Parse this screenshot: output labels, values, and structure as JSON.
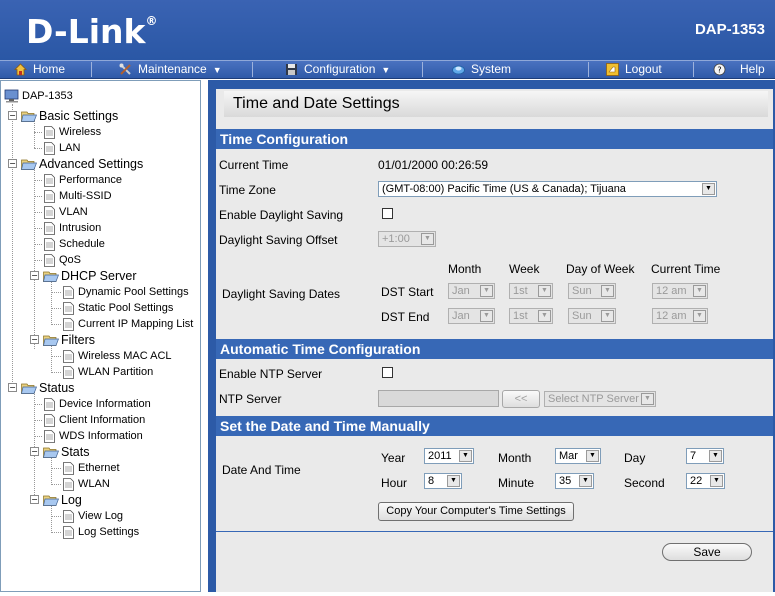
{
  "header": {
    "logo_text": "D-Link",
    "logo_mark": "®",
    "model": "DAP-1353"
  },
  "menu": {
    "home": "Home",
    "maintenance": "Maintenance",
    "configuration": "Configuration",
    "system": "System",
    "logout": "Logout",
    "help": "Help",
    "dropdown_glyph": "▼"
  },
  "tree": {
    "root": "DAP-1353",
    "basic": "Basic Settings",
    "wireless": "Wireless",
    "lan": "LAN",
    "advanced": "Advanced Settings",
    "performance": "Performance",
    "multi_ssid": "Multi-SSID",
    "vlan": "VLAN",
    "intrusion": "Intrusion",
    "schedule": "Schedule",
    "qos": "QoS",
    "dhcp": "DHCP Server",
    "dynamic_pool": "Dynamic Pool Settings",
    "static_pool": "Static Pool Settings",
    "ip_mapping": "Current IP Mapping List",
    "filters": "Filters",
    "mac_acl": "Wireless MAC ACL",
    "wlan_partition": "WLAN Partition",
    "status": "Status",
    "device_info": "Device Information",
    "client_info": "Client Information",
    "wds_info": "WDS Information",
    "stats": "Stats",
    "ethernet": "Ethernet",
    "wlan": "WLAN",
    "log": "Log",
    "view_log": "View Log",
    "log_settings": "Log Settings",
    "minus": "−"
  },
  "page": {
    "title": "Time and Date Settings"
  },
  "time_config": {
    "heading": "Time Configuration",
    "current_time_label": "Current Time",
    "current_time_value": "01/01/2000 00:26:59",
    "time_zone_label": "Time Zone",
    "time_zone_value": "(GMT-08:00) Pacific Time (US & Canada); Tijuana",
    "daylight_label": "Enable Daylight Saving",
    "offset_label": "Daylight Saving Offset",
    "offset_value": "+1:00",
    "dates_label": "Daylight Saving Dates",
    "col_month": "Month",
    "col_week": "Week",
    "col_dow": "Day of Week",
    "col_time": "Current Time",
    "dst_start_label": "DST Start",
    "dst_end_label": "DST End",
    "dst_start": {
      "month": "Jan",
      "week": "1st",
      "dow": "Sun",
      "time": "12 am"
    },
    "dst_end": {
      "month": "Jan",
      "week": "1st",
      "dow": "Sun",
      "time": "12 am"
    }
  },
  "auto_time": {
    "heading": "Automatic Time Configuration",
    "ntp_enable_label": "Enable NTP Server",
    "ntp_server_label": "NTP Server",
    "copy_btn": "<<",
    "select_placeholder": "Select NTP Server"
  },
  "manual": {
    "heading": "Set the Date and Time Manually",
    "date_time_label": "Date And Time",
    "year_label": "Year",
    "year_value": "2011",
    "month_label": "Month",
    "month_value": "Mar",
    "day_label": "Day",
    "day_value": "7",
    "hour_label": "Hour",
    "hour_value": "8",
    "minute_label": "Minute",
    "minute_value": "35",
    "second_label": "Second",
    "second_value": "22",
    "copy_computer_btn": "Copy Your Computer's Time Settings"
  },
  "actions": {
    "save": "Save"
  },
  "colors": {
    "header_blue": "#2a57a5",
    "section_blue": "#3768b6",
    "panel_gray": "#eaeaea"
  }
}
